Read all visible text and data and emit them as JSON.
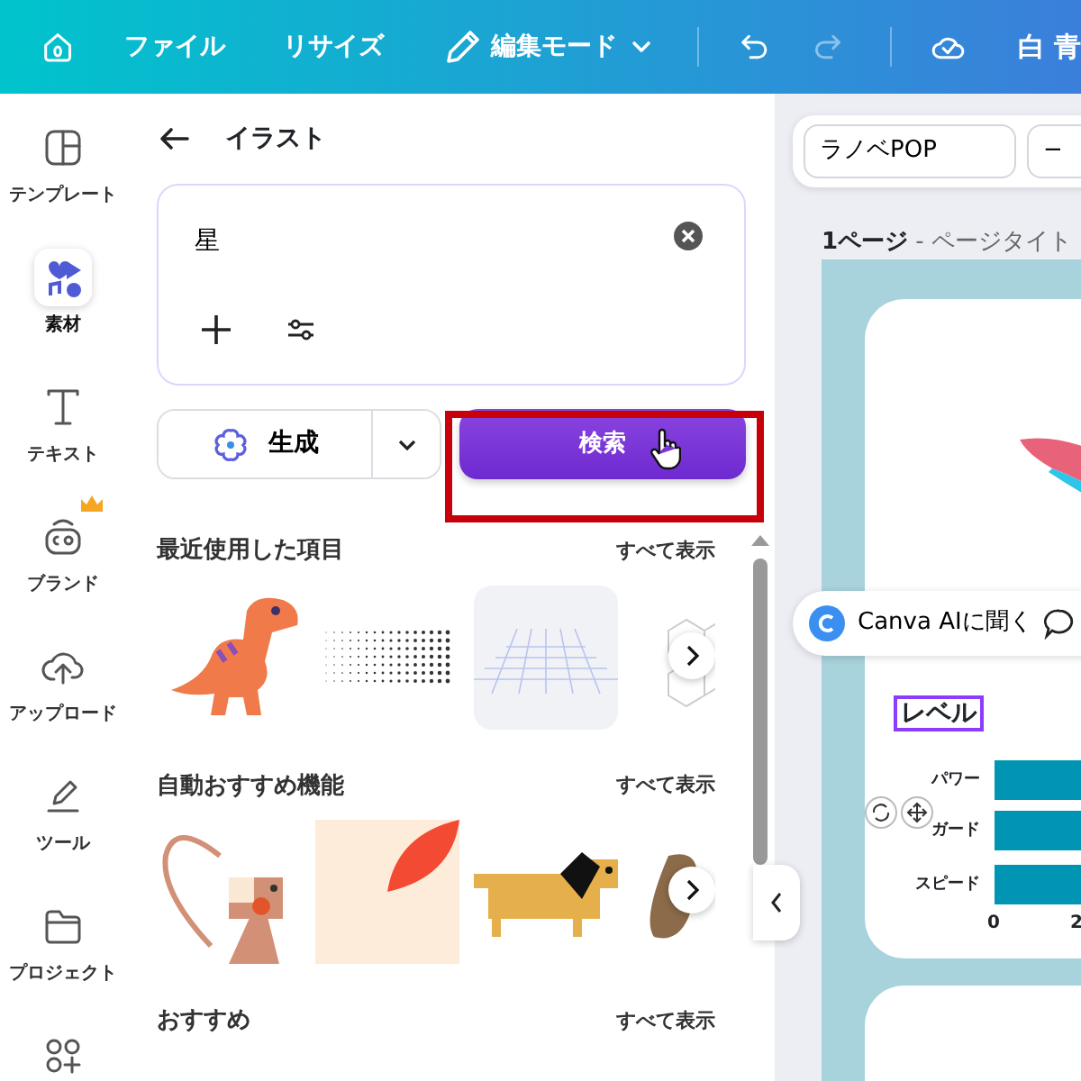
{
  "top_bar": {
    "menus": [
      {
        "kind": "home"
      },
      {
        "kind": "text",
        "label": "ファイル"
      },
      {
        "kind": "text",
        "label": "リサイズ"
      },
      {
        "kind": "mode",
        "label": "編集モード"
      },
      {
        "kind": "undo",
        "disabled": false
      },
      {
        "kind": "redo",
        "disabled": true
      },
      {
        "kind": "saved"
      }
    ],
    "document_title": "白 青"
  },
  "rail": {
    "items": [
      {
        "label": "テンプレート",
        "selected": false
      },
      {
        "label": "素材",
        "selected": true
      },
      {
        "label": "テキスト",
        "selected": false
      },
      {
        "label": "ブランド",
        "selected": false,
        "premium": true
      },
      {
        "label": "アップロード",
        "selected": false
      },
      {
        "label": "ツール",
        "selected": false
      },
      {
        "label": "プロジェクト",
        "selected": false
      },
      {
        "selected": false
      }
    ]
  },
  "panel": {
    "title": "イラスト",
    "search": {
      "value": "星"
    },
    "generate_button": "生成",
    "search_button": "検索",
    "search_button_highlighted": true,
    "sections": [
      {
        "title": "最近使用した項目",
        "see_all": "すべて表示"
      },
      {
        "title": "自動おすすめ機能",
        "see_all": "すべて表示"
      },
      {
        "title": "おすすめ",
        "see_all": "すべて表示"
      }
    ]
  },
  "editor": {
    "font": "ラノベPOP",
    "size_button": "−",
    "page_number": "1ページ",
    "page_title": " - ページタイト",
    "ai_button": "Canva AIに聞く",
    "design": {
      "heading": "レベル",
      "bar_labels": [
        "パワー",
        "ガード",
        "スピード"
      ],
      "ticks": [
        "0",
        "2"
      ]
    }
  }
}
